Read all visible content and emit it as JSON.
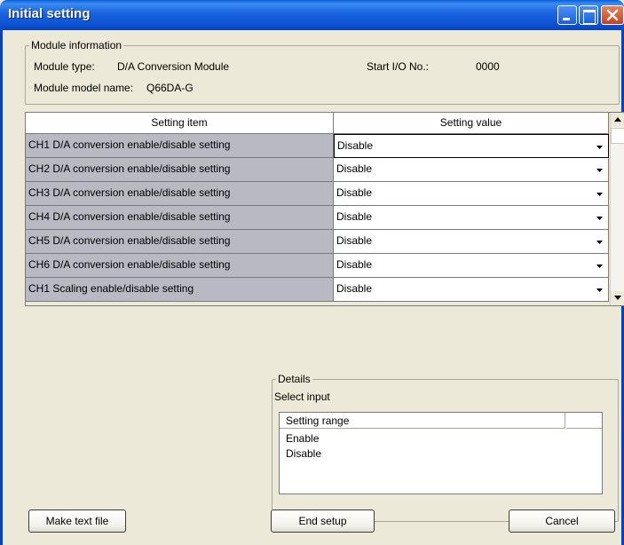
{
  "window": {
    "title": "Initial setting"
  },
  "module_info": {
    "legend": "Module information",
    "type_label": "Module type:",
    "type_value": "D/A Conversion Module",
    "model_label": "Module model name:",
    "model_value": "Q66DA-G",
    "start_io_label": "Start I/O No.:",
    "start_io_value": "0000"
  },
  "grid": {
    "headers": [
      "Setting item",
      "Setting value"
    ],
    "rows": [
      {
        "item": "CH1 D/A conversion enable/disable setting",
        "value": "Disable"
      },
      {
        "item": "CH2 D/A conversion enable/disable setting",
        "value": "Disable"
      },
      {
        "item": "CH3 D/A conversion enable/disable setting",
        "value": "Disable"
      },
      {
        "item": "CH4 D/A conversion enable/disable setting",
        "value": "Disable"
      },
      {
        "item": "CH5 D/A conversion enable/disable setting",
        "value": "Disable"
      },
      {
        "item": "CH6 D/A conversion enable/disable setting",
        "value": "Disable"
      },
      {
        "item": "CH1 Scaling enable/disable setting",
        "value": "Disable"
      }
    ]
  },
  "details": {
    "legend": "Details",
    "select_input": "Select input",
    "list_header": "Setting range",
    "options": [
      "Enable",
      "Disable"
    ]
  },
  "buttons": {
    "make_text_file": "Make text file",
    "end_setup": "End setup",
    "cancel": "Cancel"
  },
  "colors": {
    "titlebar": "#0a4fd0",
    "item_cell": "#b9b9c4",
    "dialog_bg": "#ece9d8"
  },
  "icons": {
    "minimize": "minimize-icon",
    "maximize": "maximize-icon",
    "close": "close-icon",
    "dropdown": "chevron-down-icon",
    "scroll_up": "scroll-up-icon",
    "scroll_down": "scroll-down-icon"
  }
}
